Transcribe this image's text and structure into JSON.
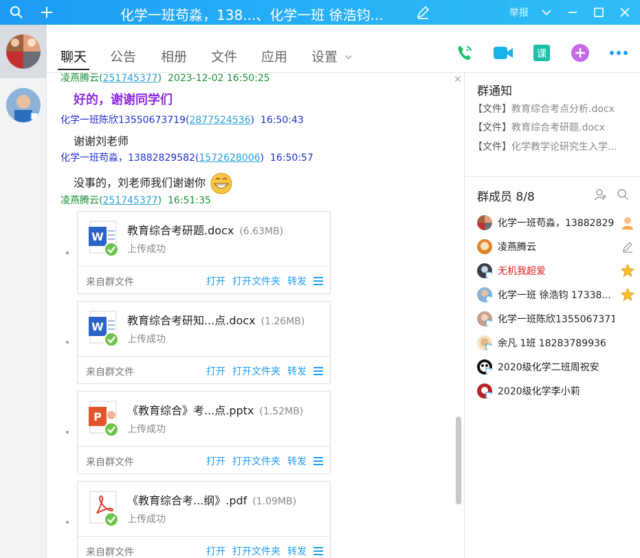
{
  "titlebar": {
    "title": "化学一班苟淼，138...、化学一班 徐浩钧...",
    "report_label": "举报"
  },
  "tabs": [
    {
      "label": "聊天"
    },
    {
      "label": "公告"
    },
    {
      "label": "相册"
    },
    {
      "label": "文件"
    },
    {
      "label": "应用"
    },
    {
      "label": "设置"
    }
  ],
  "chat": {
    "messages": [
      {
        "sender": "凌燕腾云",
        "uid": "251745377",
        "time": "2023-12-02 16:50:25",
        "text": "好的，谢谢同学们"
      },
      {
        "sender": "化学一班陈欣13550673719",
        "uid": "2877524536",
        "time": "16:50:43",
        "text": "谢谢刘老师"
      },
      {
        "sender": "化学一班苟淼，13882829582",
        "uid": "1572628006",
        "time": "16:50:57",
        "text": "没事的，刘老师我们谢谢你"
      },
      {
        "sender": "凌燕腾云",
        "uid": "251745377",
        "time": "16:51:35"
      }
    ],
    "files": [
      {
        "name": "教育综合考研题.docx",
        "size": "(6.63MB)",
        "type": "word"
      },
      {
        "name": "教育综合考研知...点.docx",
        "size": "(1.26MB)",
        "type": "word"
      },
      {
        "name": "《教育综合》考...点.pptx",
        "size": "(1.52MB)",
        "type": "ppt"
      },
      {
        "name": "《教育综合考...纲》.pdf",
        "size": "(1.09MB)",
        "type": "pdf"
      }
    ],
    "file_status": "上传成功",
    "file_source": "来自群文件",
    "action_open": "打开",
    "action_open_folder": "打开文件夹",
    "action_forward": "转发"
  },
  "notice": {
    "title": "群通知",
    "items": [
      {
        "tag": "【文件】",
        "name": "教育综合考点分析.docx"
      },
      {
        "tag": "【文件】",
        "name": "教育综合考研题.docx"
      },
      {
        "tag": "【文件】",
        "name": "化学教学论研究生入学..."
      }
    ]
  },
  "members": {
    "title": "群成员 8/8",
    "list": [
      {
        "name": "化学一班苟淼，13882829582",
        "badge": "owner"
      },
      {
        "name": "凌燕腾云",
        "badge": "edit"
      },
      {
        "name": "无机我超爱",
        "badge": "star",
        "red": true
      },
      {
        "name": "化学一班 徐浩钧 17338...",
        "badge": "star"
      },
      {
        "name": "化学一班陈欣13550673719"
      },
      {
        "name": "余凡 1班 18283789936"
      },
      {
        "name": "2020级化学二班周祝安"
      },
      {
        "name": "2020级化学李小莉"
      }
    ]
  },
  "colors": {
    "accent": "#1e9cf4",
    "green_name": "#1a8f3a",
    "blue_name": "#1d2fd1",
    "purple_text": "#8a2be2",
    "red_name": "#e02020"
  }
}
